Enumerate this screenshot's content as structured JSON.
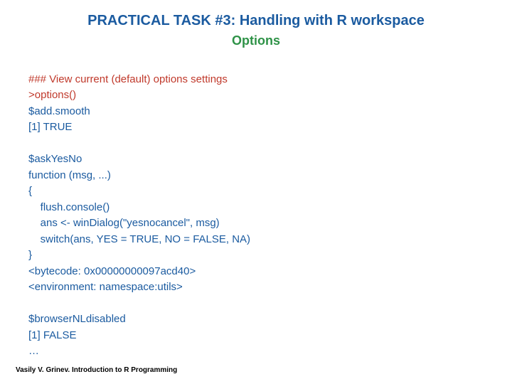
{
  "title": "PRACTICAL TASK #3: Handling with R workspace",
  "subtitle": "Options",
  "code": {
    "comment": "### View current (default) options settings",
    "command": ">options()",
    "out1": "$add.smooth",
    "out2": "[1] TRUE",
    "out3": "",
    "out4": "$askYesNo",
    "out5": "function (msg, ...)",
    "out6": "{",
    "out7": "    flush.console()",
    "out8": "    ans <- winDialog(\"yesnocancel\", msg)",
    "out9": "    switch(ans, YES = TRUE, NO = FALSE, NA)",
    "out10": "}",
    "out11": "<bytecode: 0x00000000097acd40>",
    "out12": "<environment: namespace:utils>",
    "out13": "",
    "out14": "$browserNLdisabled",
    "out15": "[1] FALSE",
    "out16": "…"
  },
  "footer": "Vasily V. Grinev. Introduction to R Programming"
}
